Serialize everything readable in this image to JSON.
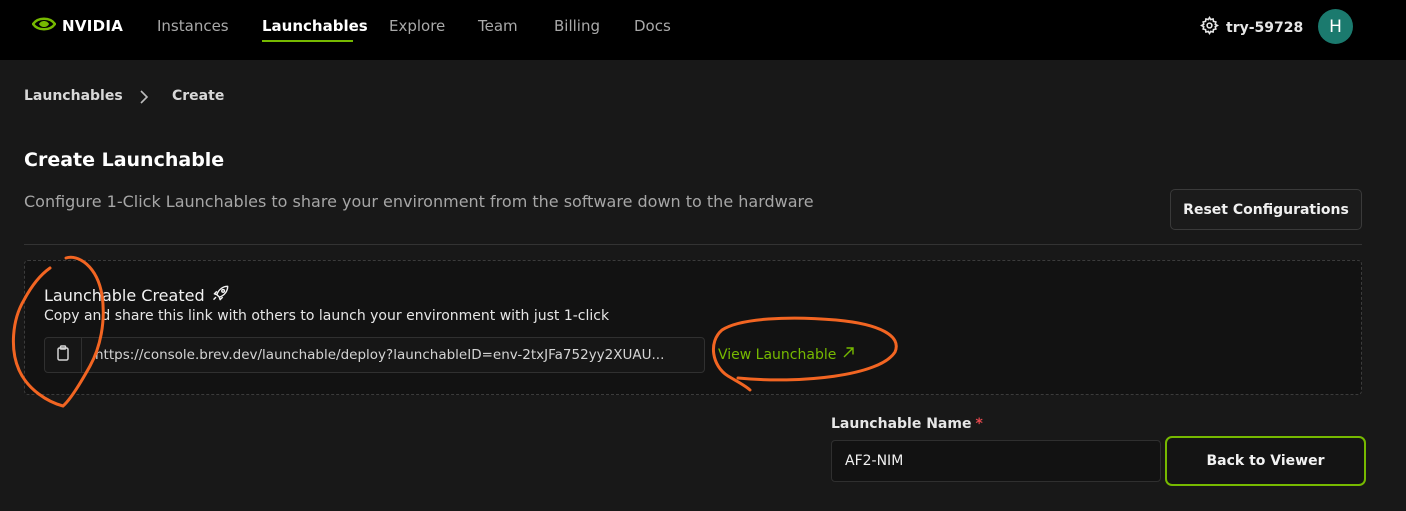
{
  "header": {
    "logo_text": "NVIDIA",
    "nav": [
      {
        "label": "Instances"
      },
      {
        "label": "Launchables"
      },
      {
        "label": "Explore"
      },
      {
        "label": "Team"
      },
      {
        "label": "Billing"
      },
      {
        "label": "Docs"
      }
    ],
    "active_nav": "Launchables",
    "account_name": "try-59728",
    "avatar_initial": "H"
  },
  "breadcrumb": {
    "items": [
      "Launchables",
      "Create"
    ]
  },
  "page": {
    "title": "Create Launchable",
    "subtitle": "Configure 1-Click Launchables to share your environment from the software down to the hardware",
    "reset_label": "Reset Configurations"
  },
  "created": {
    "title": "Launchable Created",
    "description": "Copy and share this link with others to launch your environment with just 1-click",
    "link": "https://console.brev.dev/launchable/deploy?launchableID=env-2txJFa752yy2XUAU...",
    "view_label": "View Launchable"
  },
  "form": {
    "name_label": "Launchable Name",
    "required_mark": "*",
    "name_value": "AF2-NIM",
    "back_label": "Back to Viewer"
  },
  "colors": {
    "accent": "#76b900",
    "annotation": "#f26522",
    "avatar": "#1b7a6e",
    "required": "#e5484d"
  }
}
